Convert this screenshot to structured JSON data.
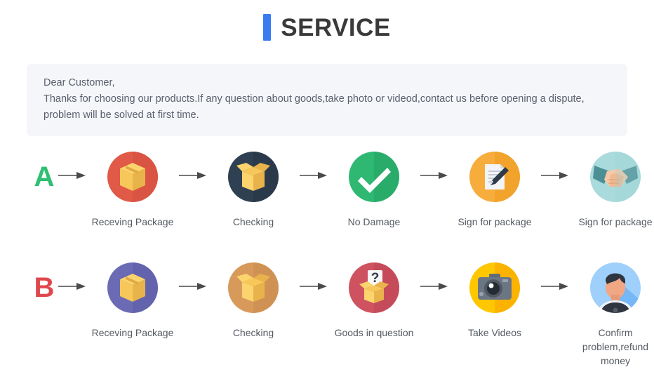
{
  "header": {
    "title": "SERVICE",
    "accent_color": "#3b7bf0"
  },
  "notice": {
    "greeting": "Dear Customer,",
    "line2": "Thanks for choosing our products.If any question about goods,take photo or videod,contact us before opening a dispute,",
    "line3": "problem will be solved at first time.",
    "background_color": "#f5f6fa"
  },
  "flows": [
    {
      "letter": "A",
      "letter_color": "#2fbf71",
      "steps": [
        {
          "label": "Receving Package",
          "icon": "closed-box-icon",
          "circle_color": "#e05a47",
          "shadow_color": "#cb4e3d"
        },
        {
          "label": "Checking",
          "icon": "open-box-icon",
          "circle_color": "#2f4052",
          "shadow_color": "#263543"
        },
        {
          "label": "No Damage",
          "icon": "check-mark-icon",
          "circle_color": "#2eb872",
          "shadow_color": "#28a263"
        },
        {
          "label": "Sign for package",
          "icon": "document-pen-icon",
          "circle_color": "#f6ad3c",
          "shadow_color": "#f0991f"
        },
        {
          "label": "Sign for package",
          "icon": "handshake-icon",
          "circle_color": "#a9dbdc",
          "shadow_color": "#97cfd1"
        }
      ]
    },
    {
      "letter": "B",
      "letter_color": "#e0474c",
      "steps": [
        {
          "label": "Receving Package",
          "icon": "closed-box-icon",
          "circle_color": "#6b6bb5",
          "shadow_color": "#5c5ca3"
        },
        {
          "label": "Checking",
          "icon": "open-box-icon",
          "circle_color": "#d79a5b",
          "shadow_color": "#c98b4c"
        },
        {
          "label": "Goods in question",
          "icon": "question-box-icon",
          "circle_color": "#cf5260",
          "shadow_color": "#bd4655"
        },
        {
          "label": "Take Videos",
          "icon": "camera-icon",
          "circle_color": "#ffc700",
          "shadow_color": "#f9ac00"
        },
        {
          "label": "Confirm  problem,refund money",
          "icon": "person-icon",
          "circle_color": "#9fd0fb",
          "shadow_color": "#5aa9f5"
        }
      ]
    }
  ],
  "arrow": {
    "name": "right-arrow-icon",
    "color": "#4a4a4a"
  }
}
